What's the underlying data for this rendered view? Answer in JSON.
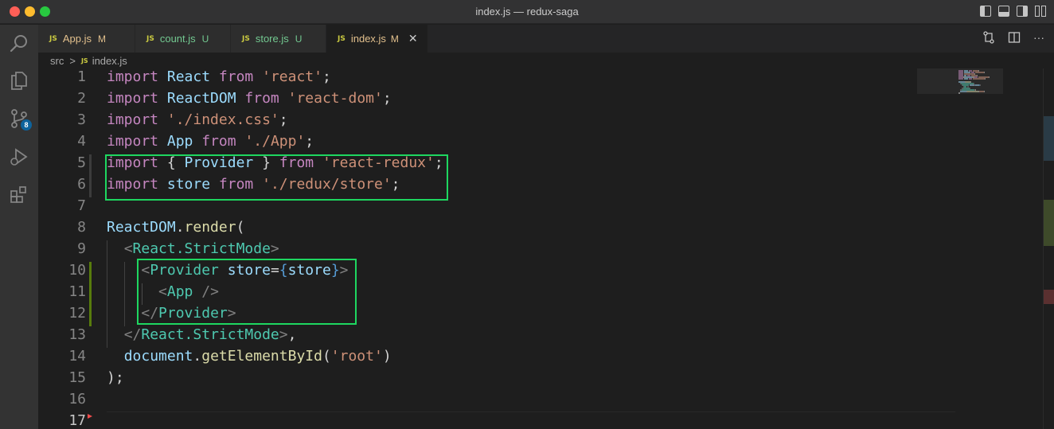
{
  "window": {
    "title": "index.js — redux-saga"
  },
  "activity_bar": {
    "items": [
      {
        "name": "explorer",
        "icon": "files-icon"
      },
      {
        "name": "search",
        "icon": "search-icon"
      },
      {
        "name": "source-control",
        "icon": "source-control-icon",
        "badge": "8"
      },
      {
        "name": "run-debug",
        "icon": "debug-icon"
      },
      {
        "name": "extensions",
        "icon": "extensions-icon"
      }
    ]
  },
  "tabs": [
    {
      "badge": "JS",
      "label": "App.js",
      "status": "M",
      "active": false
    },
    {
      "badge": "JS",
      "label": "count.js",
      "status": "U",
      "active": false
    },
    {
      "badge": "JS",
      "label": "store.js",
      "status": "U",
      "active": false
    },
    {
      "badge": "JS",
      "label": "index.js",
      "status": "M",
      "active": true,
      "close": "✕"
    }
  ],
  "editor_actions": {
    "more": "···"
  },
  "breadcrumb": {
    "folder": "src",
    "separator": ">",
    "file_badge": "JS",
    "file": "index.js"
  },
  "editor": {
    "line_numbers": [
      "1",
      "2",
      "3",
      "4",
      "5",
      "6",
      "7",
      "8",
      "9",
      "10",
      "11",
      "12",
      "13",
      "14",
      "15",
      "16",
      "17"
    ],
    "current_line": "17",
    "lines": [
      [
        [
          "kw",
          "import"
        ],
        [
          "plain",
          " "
        ],
        [
          "var",
          "React"
        ],
        [
          "plain",
          " "
        ],
        [
          "kw",
          "from"
        ],
        [
          "plain",
          " "
        ],
        [
          "str",
          "'react'"
        ],
        [
          "plain",
          ";"
        ]
      ],
      [
        [
          "kw",
          "import"
        ],
        [
          "plain",
          " "
        ],
        [
          "var",
          "ReactDOM"
        ],
        [
          "plain",
          " "
        ],
        [
          "kw",
          "from"
        ],
        [
          "plain",
          " "
        ],
        [
          "str",
          "'react-dom'"
        ],
        [
          "plain",
          ";"
        ]
      ],
      [
        [
          "kw",
          "import"
        ],
        [
          "plain",
          " "
        ],
        [
          "str",
          "'./index.css'"
        ],
        [
          "plain",
          ";"
        ]
      ],
      [
        [
          "kw",
          "import"
        ],
        [
          "plain",
          " "
        ],
        [
          "var",
          "App"
        ],
        [
          "plain",
          " "
        ],
        [
          "kw",
          "from"
        ],
        [
          "plain",
          " "
        ],
        [
          "str",
          "'./App'"
        ],
        [
          "plain",
          ";"
        ]
      ],
      [
        [
          "kw",
          "import"
        ],
        [
          "plain",
          " { "
        ],
        [
          "var",
          "Provider"
        ],
        [
          "plain",
          " } "
        ],
        [
          "kw",
          "from"
        ],
        [
          "plain",
          " "
        ],
        [
          "str",
          "'react-redux'"
        ],
        [
          "plain",
          ";"
        ]
      ],
      [
        [
          "kw",
          "import"
        ],
        [
          "plain",
          " "
        ],
        [
          "var",
          "store"
        ],
        [
          "plain",
          " "
        ],
        [
          "kw",
          "from"
        ],
        [
          "plain",
          " "
        ],
        [
          "str",
          "'./redux/store'"
        ],
        [
          "plain",
          ";"
        ]
      ],
      [],
      [
        [
          "var",
          "ReactDOM"
        ],
        [
          "plain",
          "."
        ],
        [
          "fn",
          "render"
        ],
        [
          "plain",
          "("
        ]
      ],
      [
        [
          "plain",
          "  "
        ],
        [
          "pun",
          "<"
        ],
        [
          "tag",
          "React.StrictMode"
        ],
        [
          "pun",
          ">"
        ]
      ],
      [
        [
          "plain",
          "    "
        ],
        [
          "pun",
          "<"
        ],
        [
          "tag",
          "Provider"
        ],
        [
          "plain",
          " "
        ],
        [
          "var",
          "store"
        ],
        [
          "plain",
          "="
        ],
        [
          "brace",
          "{"
        ],
        [
          "var",
          "store"
        ],
        [
          "brace",
          "}"
        ],
        [
          "pun",
          ">"
        ]
      ],
      [
        [
          "plain",
          "      "
        ],
        [
          "pun",
          "<"
        ],
        [
          "tag",
          "App"
        ],
        [
          "plain",
          " "
        ],
        [
          "pun",
          "/>"
        ]
      ],
      [
        [
          "plain",
          "    "
        ],
        [
          "pun",
          "</"
        ],
        [
          "tag",
          "Provider"
        ],
        [
          "pun",
          ">"
        ]
      ],
      [
        [
          "plain",
          "  "
        ],
        [
          "pun",
          "</"
        ],
        [
          "tag",
          "React.StrictMode"
        ],
        [
          "pun",
          ">"
        ],
        [
          "plain",
          ","
        ]
      ],
      [
        [
          "plain",
          "  "
        ],
        [
          "var",
          "document"
        ],
        [
          "plain",
          "."
        ],
        [
          "fn",
          "getElementById"
        ],
        [
          "plain",
          "("
        ],
        [
          "str",
          "'root'"
        ],
        [
          "plain",
          ")"
        ]
      ],
      [
        [
          "plain",
          ");"
        ]
      ],
      [],
      []
    ]
  },
  "colors": {
    "highlight_box": "#1ed760",
    "keyword": "#c586c0",
    "variable": "#9cdcfe",
    "string": "#ce9178",
    "function": "#dcdcaa",
    "tag": "#4ec9b0",
    "punctuation": "#808080"
  }
}
